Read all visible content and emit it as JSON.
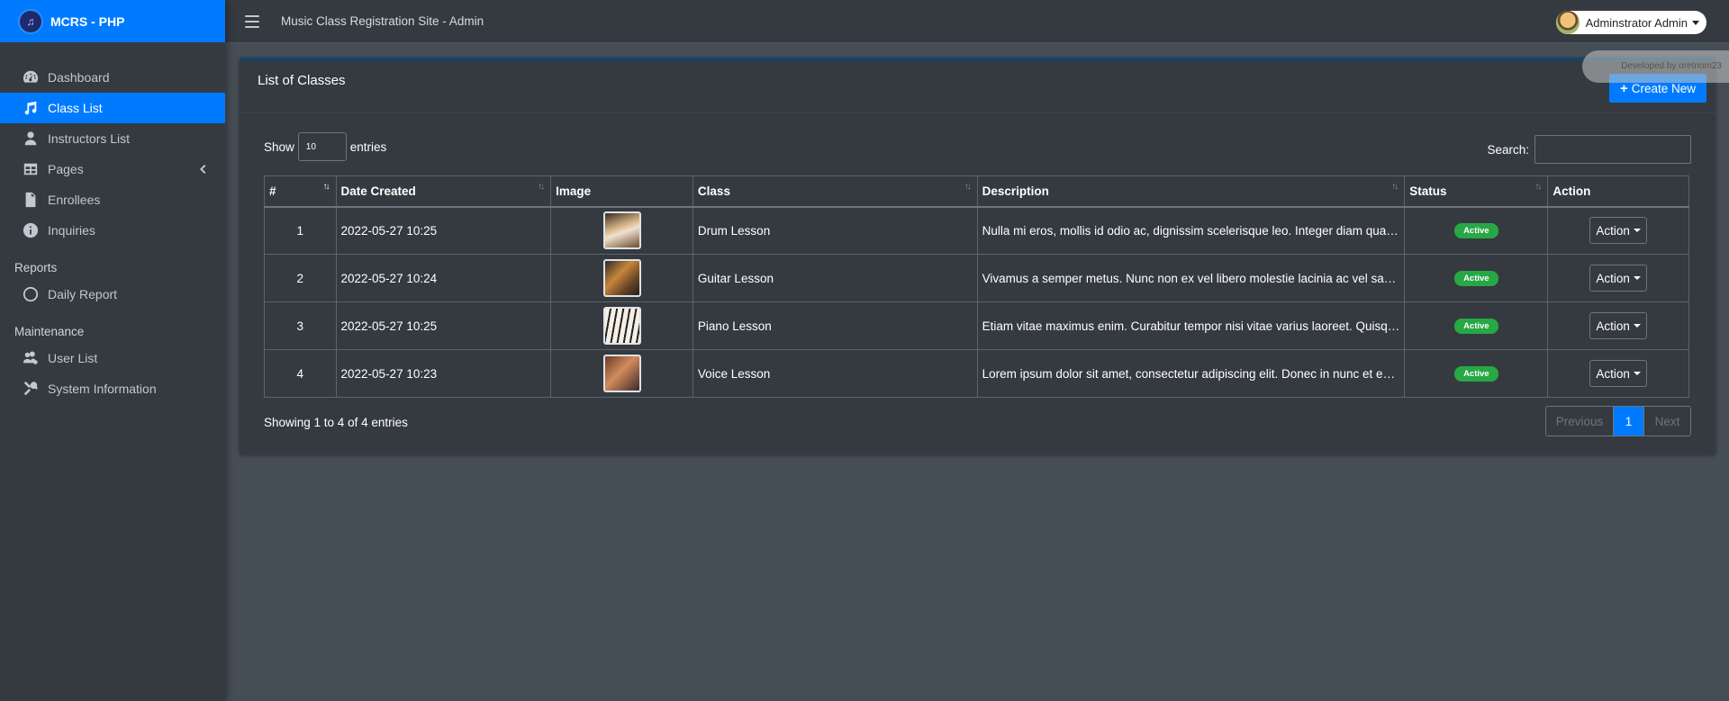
{
  "brand": {
    "name": "MCRS - PHP",
    "logo_icon": "music-note-icon"
  },
  "topbar": {
    "site_title": "Music Class Registration Site - Admin",
    "user_name": "Adminstrator Admin"
  },
  "sidebar": {
    "items": [
      {
        "label": "Dashboard",
        "icon": "tachometer-icon"
      },
      {
        "label": "Class List",
        "icon": "music-icon",
        "active": true
      },
      {
        "label": "Instructors List",
        "icon": "user-tie-icon"
      },
      {
        "label": "Pages",
        "icon": "table-icon",
        "has_children": true
      },
      {
        "label": "Enrollees",
        "icon": "file-icon"
      },
      {
        "label": "Inquiries",
        "icon": "info-circle-icon"
      }
    ],
    "reports_header": "Reports",
    "reports": [
      {
        "label": "Daily Report",
        "icon": "circle-icon"
      }
    ],
    "maintenance_header": "Maintenance",
    "maintenance": [
      {
        "label": "User List",
        "icon": "users-cog-icon"
      },
      {
        "label": "System Information",
        "icon": "tools-icon"
      }
    ]
  },
  "card": {
    "title": "List of Classes",
    "create_label": "Create New",
    "developer_credit": "Developed by oretnom23"
  },
  "controls": {
    "show_label": "Show",
    "entries_value": "10",
    "entries_label": "entries",
    "search_label": "Search:"
  },
  "table": {
    "headers": [
      "#",
      "Date Created",
      "Image",
      "Class",
      "Description",
      "Status",
      "Action"
    ],
    "rows": [
      {
        "num": "1",
        "date": "2022-05-27 10:25",
        "class": "Drum Lesson",
        "description": "Nulla mi eros, mollis id odio ac, dignissim scelerisque leo. Integer diam quam, fringilla",
        "status": "Active",
        "action": "Action"
      },
      {
        "num": "2",
        "date": "2022-05-27 10:24",
        "class": "Guitar Lesson",
        "description": "Vivamus a semper metus. Nunc non ex vel libero molestie lacinia ac vel sapien",
        "status": "Active",
        "action": "Action"
      },
      {
        "num": "3",
        "date": "2022-05-27 10:25",
        "class": "Piano Lesson",
        "description": "Etiam vitae maximus enim. Curabitur tempor nisi vitae varius laoreet. Quisque",
        "status": "Active",
        "action": "Action"
      },
      {
        "num": "4",
        "date": "2022-05-27 10:23",
        "class": "Voice Lesson",
        "description": "Lorem ipsum dolor sit amet, consectetur adipiscing elit. Donec in nunc et enim",
        "status": "Active",
        "action": "Action"
      }
    ]
  },
  "footer": {
    "info": "Showing 1 to 4 of 4 entries",
    "prev": "Previous",
    "current_page": "1",
    "next": "Next"
  },
  "colors": {
    "primary": "#007bff",
    "sidebar_bg": "#343a40",
    "content_bg": "#454d55",
    "success": "#28a745"
  }
}
